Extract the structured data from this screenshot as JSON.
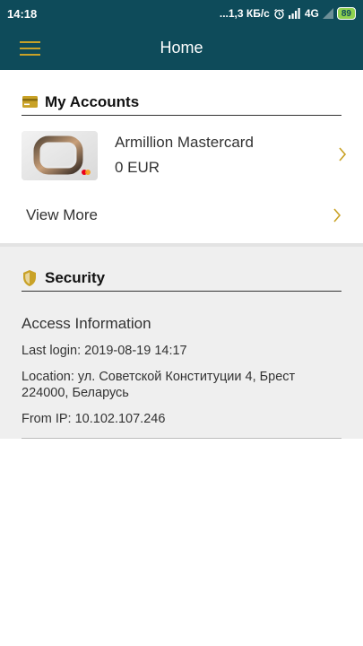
{
  "status_bar": {
    "time": "14:18",
    "network_speed": "...1,3 КБ/с",
    "network_type": "4G",
    "battery": "89"
  },
  "app_bar": {
    "title": "Home",
    "menu_icon": "hamburger-menu-icon"
  },
  "accounts_section": {
    "title": "My Accounts",
    "icon": "card-icon",
    "items": [
      {
        "name": "Armillion Mastercard",
        "balance": "0 EUR"
      }
    ],
    "view_more_label": "View More"
  },
  "security_section": {
    "title": "Security",
    "icon": "shield-icon",
    "access_title": "Access Information",
    "last_login": "Last login: 2019-08-19 14:17",
    "location": "Location: ул. Советской Конституции 4, Брест 224000, Беларусь",
    "from_ip": "From IP: 10.102.107.246"
  },
  "colors": {
    "primary": "#0e4b5a",
    "accent": "#c9a227",
    "battery": "#8fd14f",
    "section_bg": "#efefef"
  }
}
